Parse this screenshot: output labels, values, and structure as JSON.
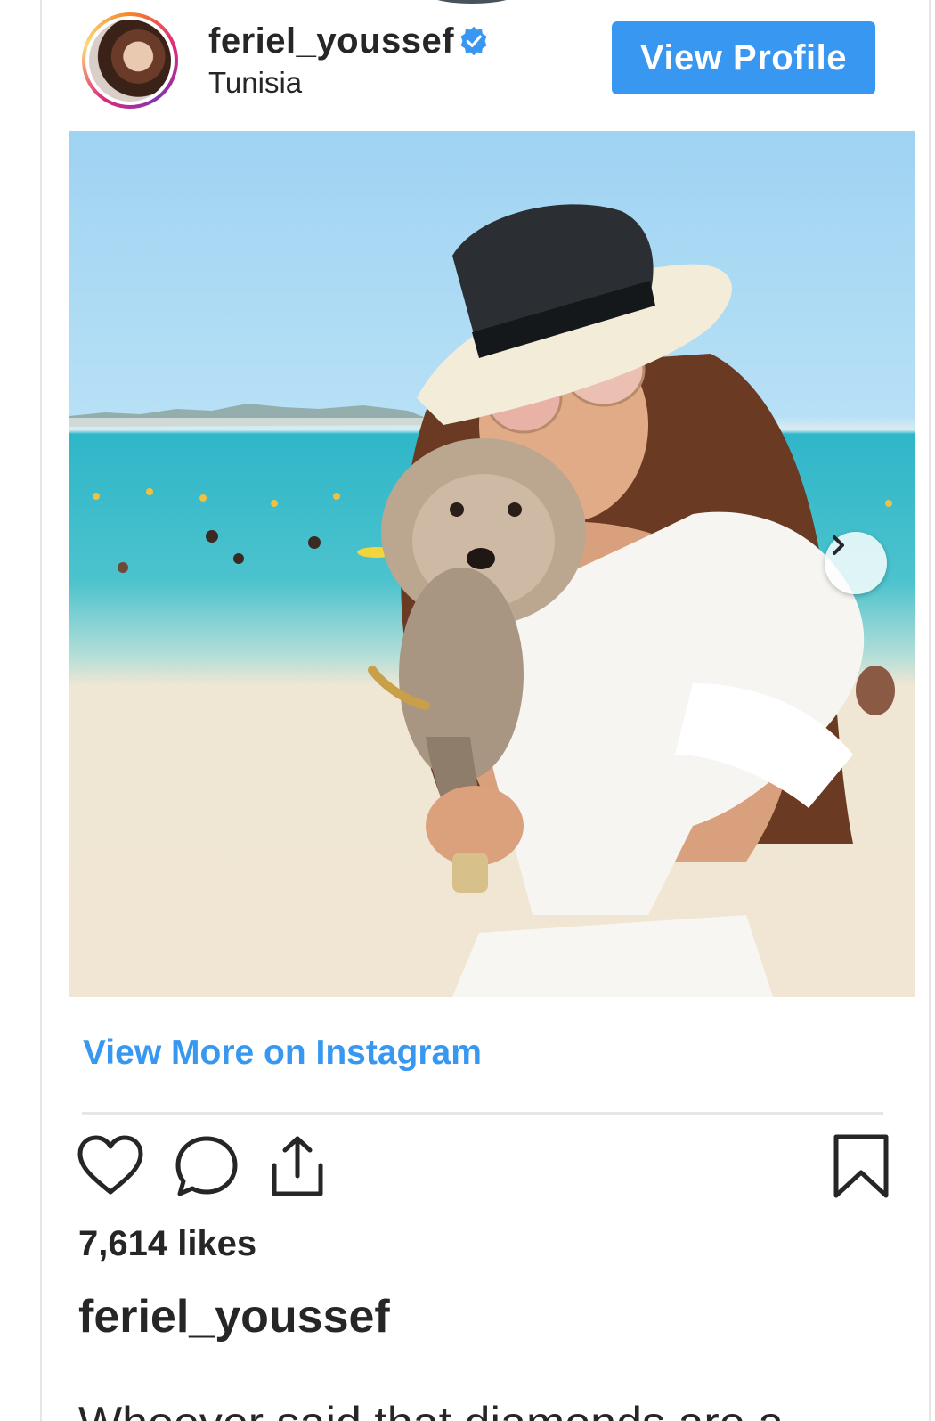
{
  "post": {
    "username": "feriel_youssef",
    "verified_icon": "verified-badge-icon",
    "location": "Tunisia",
    "view_profile_label": "View Profile",
    "view_more_label": "View More on Instagram",
    "likes_text": "7,614 likes",
    "caption_username": "feriel_youssef",
    "caption_text": "Whoever said that diamonds are a"
  },
  "icons": {
    "avatar": "profile-avatar",
    "next": "chevron-right-icon",
    "like": "heart-icon",
    "comment": "comment-bubble-icon",
    "share": "share-upload-icon",
    "save": "bookmark-icon"
  },
  "colors": {
    "accent": "#3897f0",
    "text": "#262626",
    "divider": "#e6e6e6"
  }
}
